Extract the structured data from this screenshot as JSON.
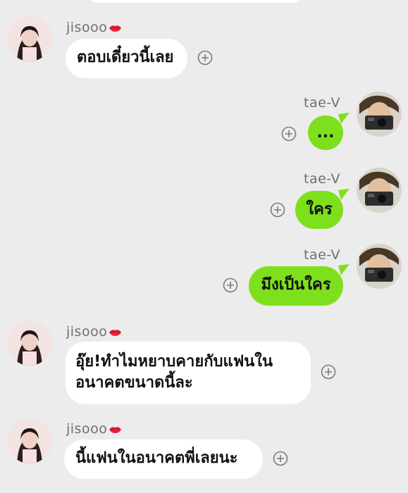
{
  "colors": {
    "background": "#ececec",
    "incoming_bubble": "#ffffff",
    "outgoing_bubble": "#7ee01c",
    "sender_name": "#6f6f6f"
  },
  "messages": [
    {
      "sender": "jisooo",
      "text": "ตอบเดี๋ยวนี้เลย"
    },
    {
      "sender": "tae-V",
      "text": "..."
    },
    {
      "sender": "tae-V",
      "text": "ใคร"
    },
    {
      "sender": "tae-V",
      "text": "มึงเป็นใคร"
    },
    {
      "sender": "jisooo",
      "line1": "อุ๊ย!ทำไมหยาบคายกับแฟนใน",
      "line2": "อนาคตขนาดนี้ละ"
    },
    {
      "sender": "jisooo",
      "text": "นี้แฟนในอนาคตพี่เลยนะ"
    }
  ],
  "icons": {
    "add": "plus-circle-icon",
    "reaction": "lips-icon"
  }
}
